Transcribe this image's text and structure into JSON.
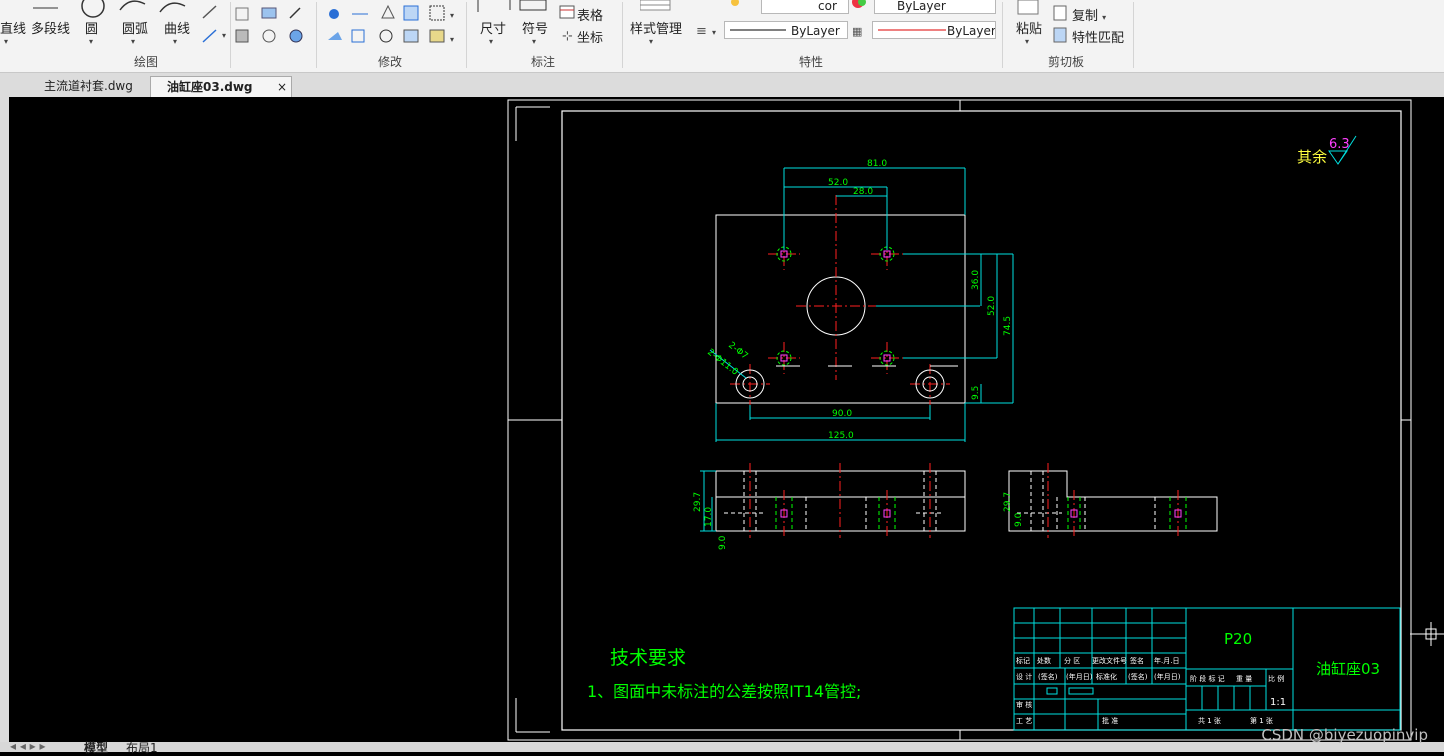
{
  "ribbon": {
    "draw": {
      "title": "绘图",
      "line": "直线",
      "polyline": "多段线",
      "circle": "圆",
      "arc": "圆弧",
      "curve": "曲线"
    },
    "modify": {
      "title": "修改"
    },
    "annotate": {
      "title": "标注",
      "dimension": "尺寸",
      "symbol": "符号",
      "table": "表格",
      "coordinate": "坐标"
    },
    "properties": {
      "title": "特性",
      "style_manager": "样式管理",
      "color_value": "ByLayer",
      "layer_value": "cor",
      "linetype": "ByLayer",
      "lineweight": "ByLayer"
    },
    "clipboard": {
      "title": "剪切板",
      "paste": "粘贴",
      "copy": "复制",
      "match": "特性匹配"
    }
  },
  "tabs": [
    {
      "label": "主流道衬套.dwg",
      "active": false
    },
    {
      "label": "油缸座03.dwg",
      "active": true,
      "close": "×"
    }
  ],
  "drawing": {
    "roughness_label": "其余",
    "roughness_value": "6.3",
    "dims": {
      "d81": "81.0",
      "d52": "52.0",
      "d28": "28.0",
      "d36": "36.0",
      "d52v": "52.0",
      "d745": "74.5",
      "d95": "9.5",
      "d90": "90.0",
      "d125": "125.0",
      "d297": "29.7",
      "d170": "17.0",
      "d90s": "9.0",
      "d297r": "29.7",
      "d90r": "9.0",
      "holes": "2-Φ11.0",
      "holes2": "2-Φ7"
    },
    "tech_title": "技术要求",
    "tech_line": "1、图面中未标注的公差按照IT14管控;",
    "title_block": {
      "material": "P20",
      "part_name": "油缸座03",
      "scale": "1:1",
      "headers": [
        "标记",
        "处数",
        "分 区",
        "更改文件号",
        "签名",
        "年.月.日"
      ],
      "row2": [
        "设 计",
        "(签名)",
        "(年月日)",
        "标准化",
        "(签名)",
        "(年月日)"
      ],
      "stage": [
        "阶 段 标 记",
        "重 量",
        "比 例"
      ],
      "footer": [
        "共 1 张",
        "第 1 张"
      ],
      "row_audit": [
        "审 核"
      ],
      "row_process": [
        "工 艺",
        "批 准"
      ]
    }
  },
  "bottom": {
    "model": "模型",
    "layout": "布局1"
  },
  "watermark": "CSDN @biyezuopinvip",
  "colors": {
    "cyan": "#00e0e0",
    "green": "#00ff00",
    "red": "#ff2020",
    "yellow": "#ffff40",
    "magenta": "#ff00ff",
    "white": "#ffffff"
  }
}
